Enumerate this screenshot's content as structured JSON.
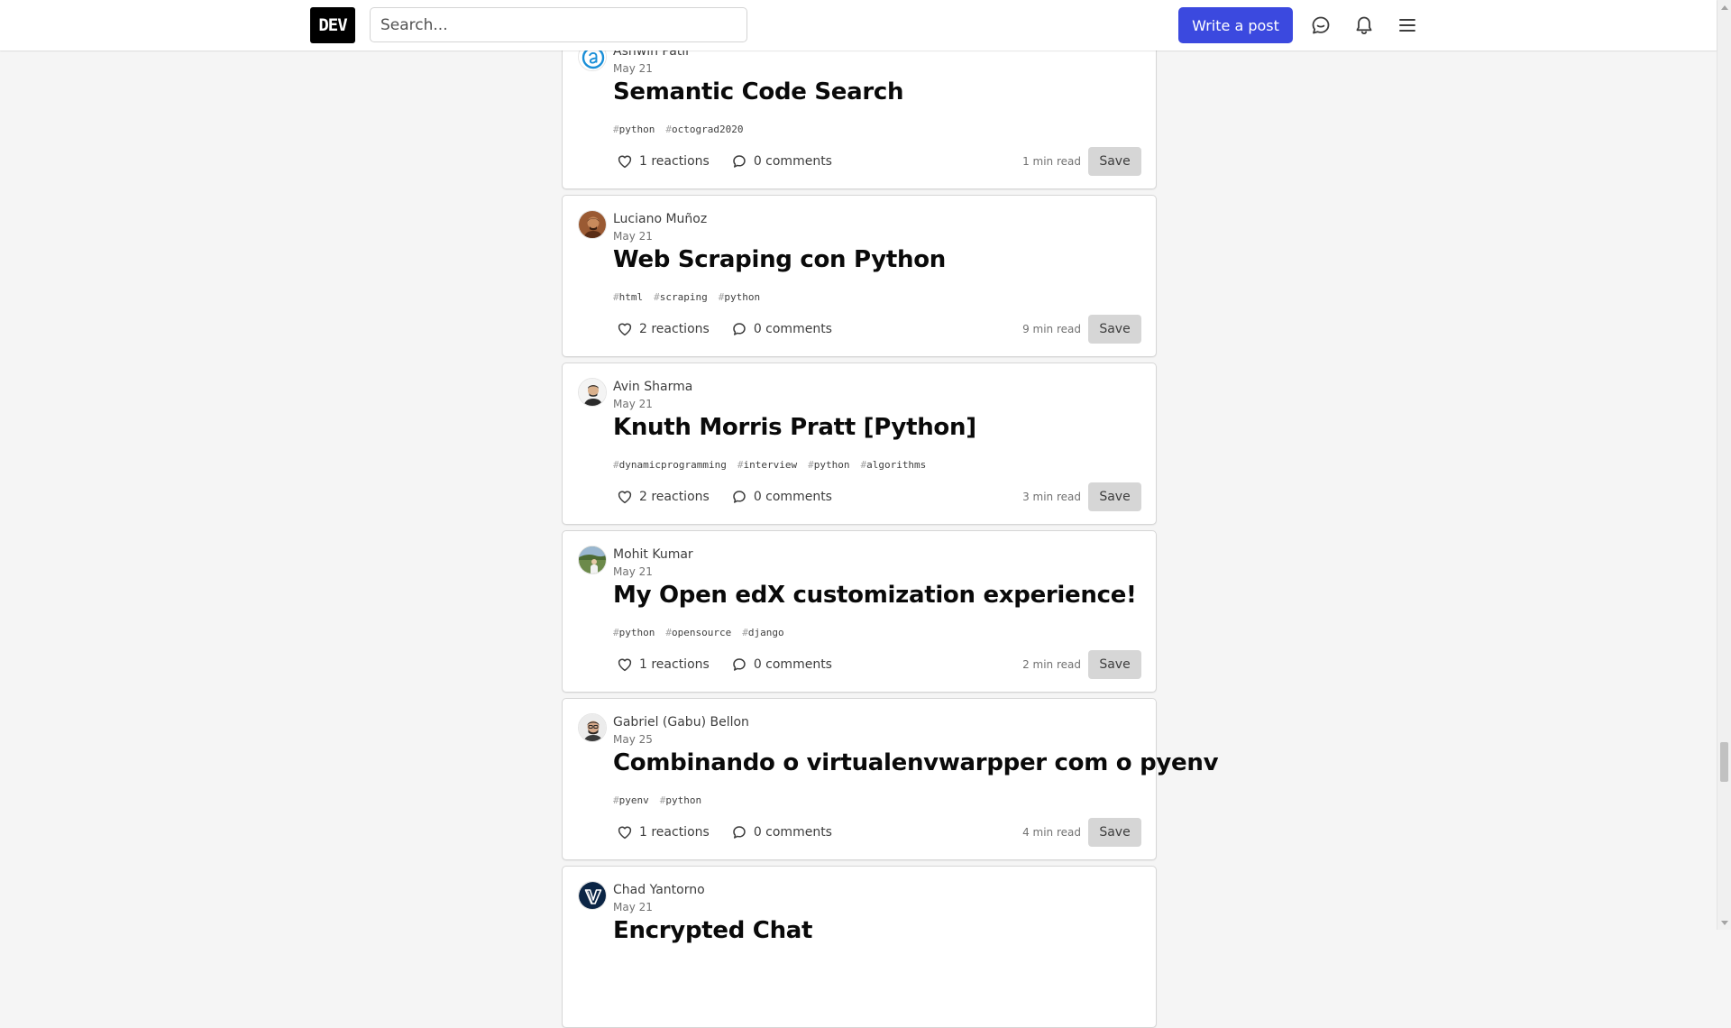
{
  "header": {
    "logo_text": "DEV",
    "search_placeholder": "Search...",
    "write_post_label": "Write a post",
    "icons": [
      "chat-icon",
      "bell-icon",
      "menu-icon"
    ]
  },
  "colors": {
    "accent": "#3b49df",
    "logo_bg": "#000000",
    "save_bg": "#d6d6d6"
  },
  "feed": {
    "save_label": "Save",
    "posts": [
      {
        "author": "Ashwin Patil",
        "date": "May 21",
        "title": "Semantic Code Search",
        "tags": [
          "python",
          "octograd2020"
        ],
        "reactions": "1 reactions",
        "comments": "0 comments",
        "read_time": "1 min read",
        "avatar": "letter-a-avatar"
      },
      {
        "author": "Luciano Muñoz",
        "date": "May 21",
        "title": "Web Scraping con Python",
        "tags": [
          "html",
          "scraping",
          "python"
        ],
        "reactions": "2 reactions",
        "comments": "0 comments",
        "read_time": "9 min read",
        "avatar": "photo-avatar"
      },
      {
        "author": "Avin Sharma",
        "date": "May 21",
        "title": "Knuth Morris Pratt [Python]",
        "tags": [
          "dynamicprogramming",
          "interview",
          "python",
          "algorithms"
        ],
        "reactions": "2 reactions",
        "comments": "0 comments",
        "read_time": "3 min read",
        "avatar": "photo-avatar"
      },
      {
        "author": "Mohit Kumar",
        "date": "May 21",
        "title": "My Open edX customization experience!",
        "tags": [
          "python",
          "opensource",
          "django"
        ],
        "reactions": "1 reactions",
        "comments": "0 comments",
        "read_time": "2 min read",
        "avatar": "photo-avatar"
      },
      {
        "author": "Gabriel (Gabu) Bellon",
        "date": "May 25",
        "title": "Combinando o virtualenvwarpper com o pyenv",
        "tags": [
          "pyenv",
          "python"
        ],
        "reactions": "1 reactions",
        "comments": "0 comments",
        "read_time": "4 min read",
        "avatar": "photo-avatar"
      },
      {
        "author": "Chad Yantorno",
        "date": "May 21",
        "title": "Encrypted Chat",
        "tags": [],
        "reactions": "",
        "comments": "",
        "read_time": "",
        "avatar": "letter-v-avatar"
      }
    ]
  }
}
